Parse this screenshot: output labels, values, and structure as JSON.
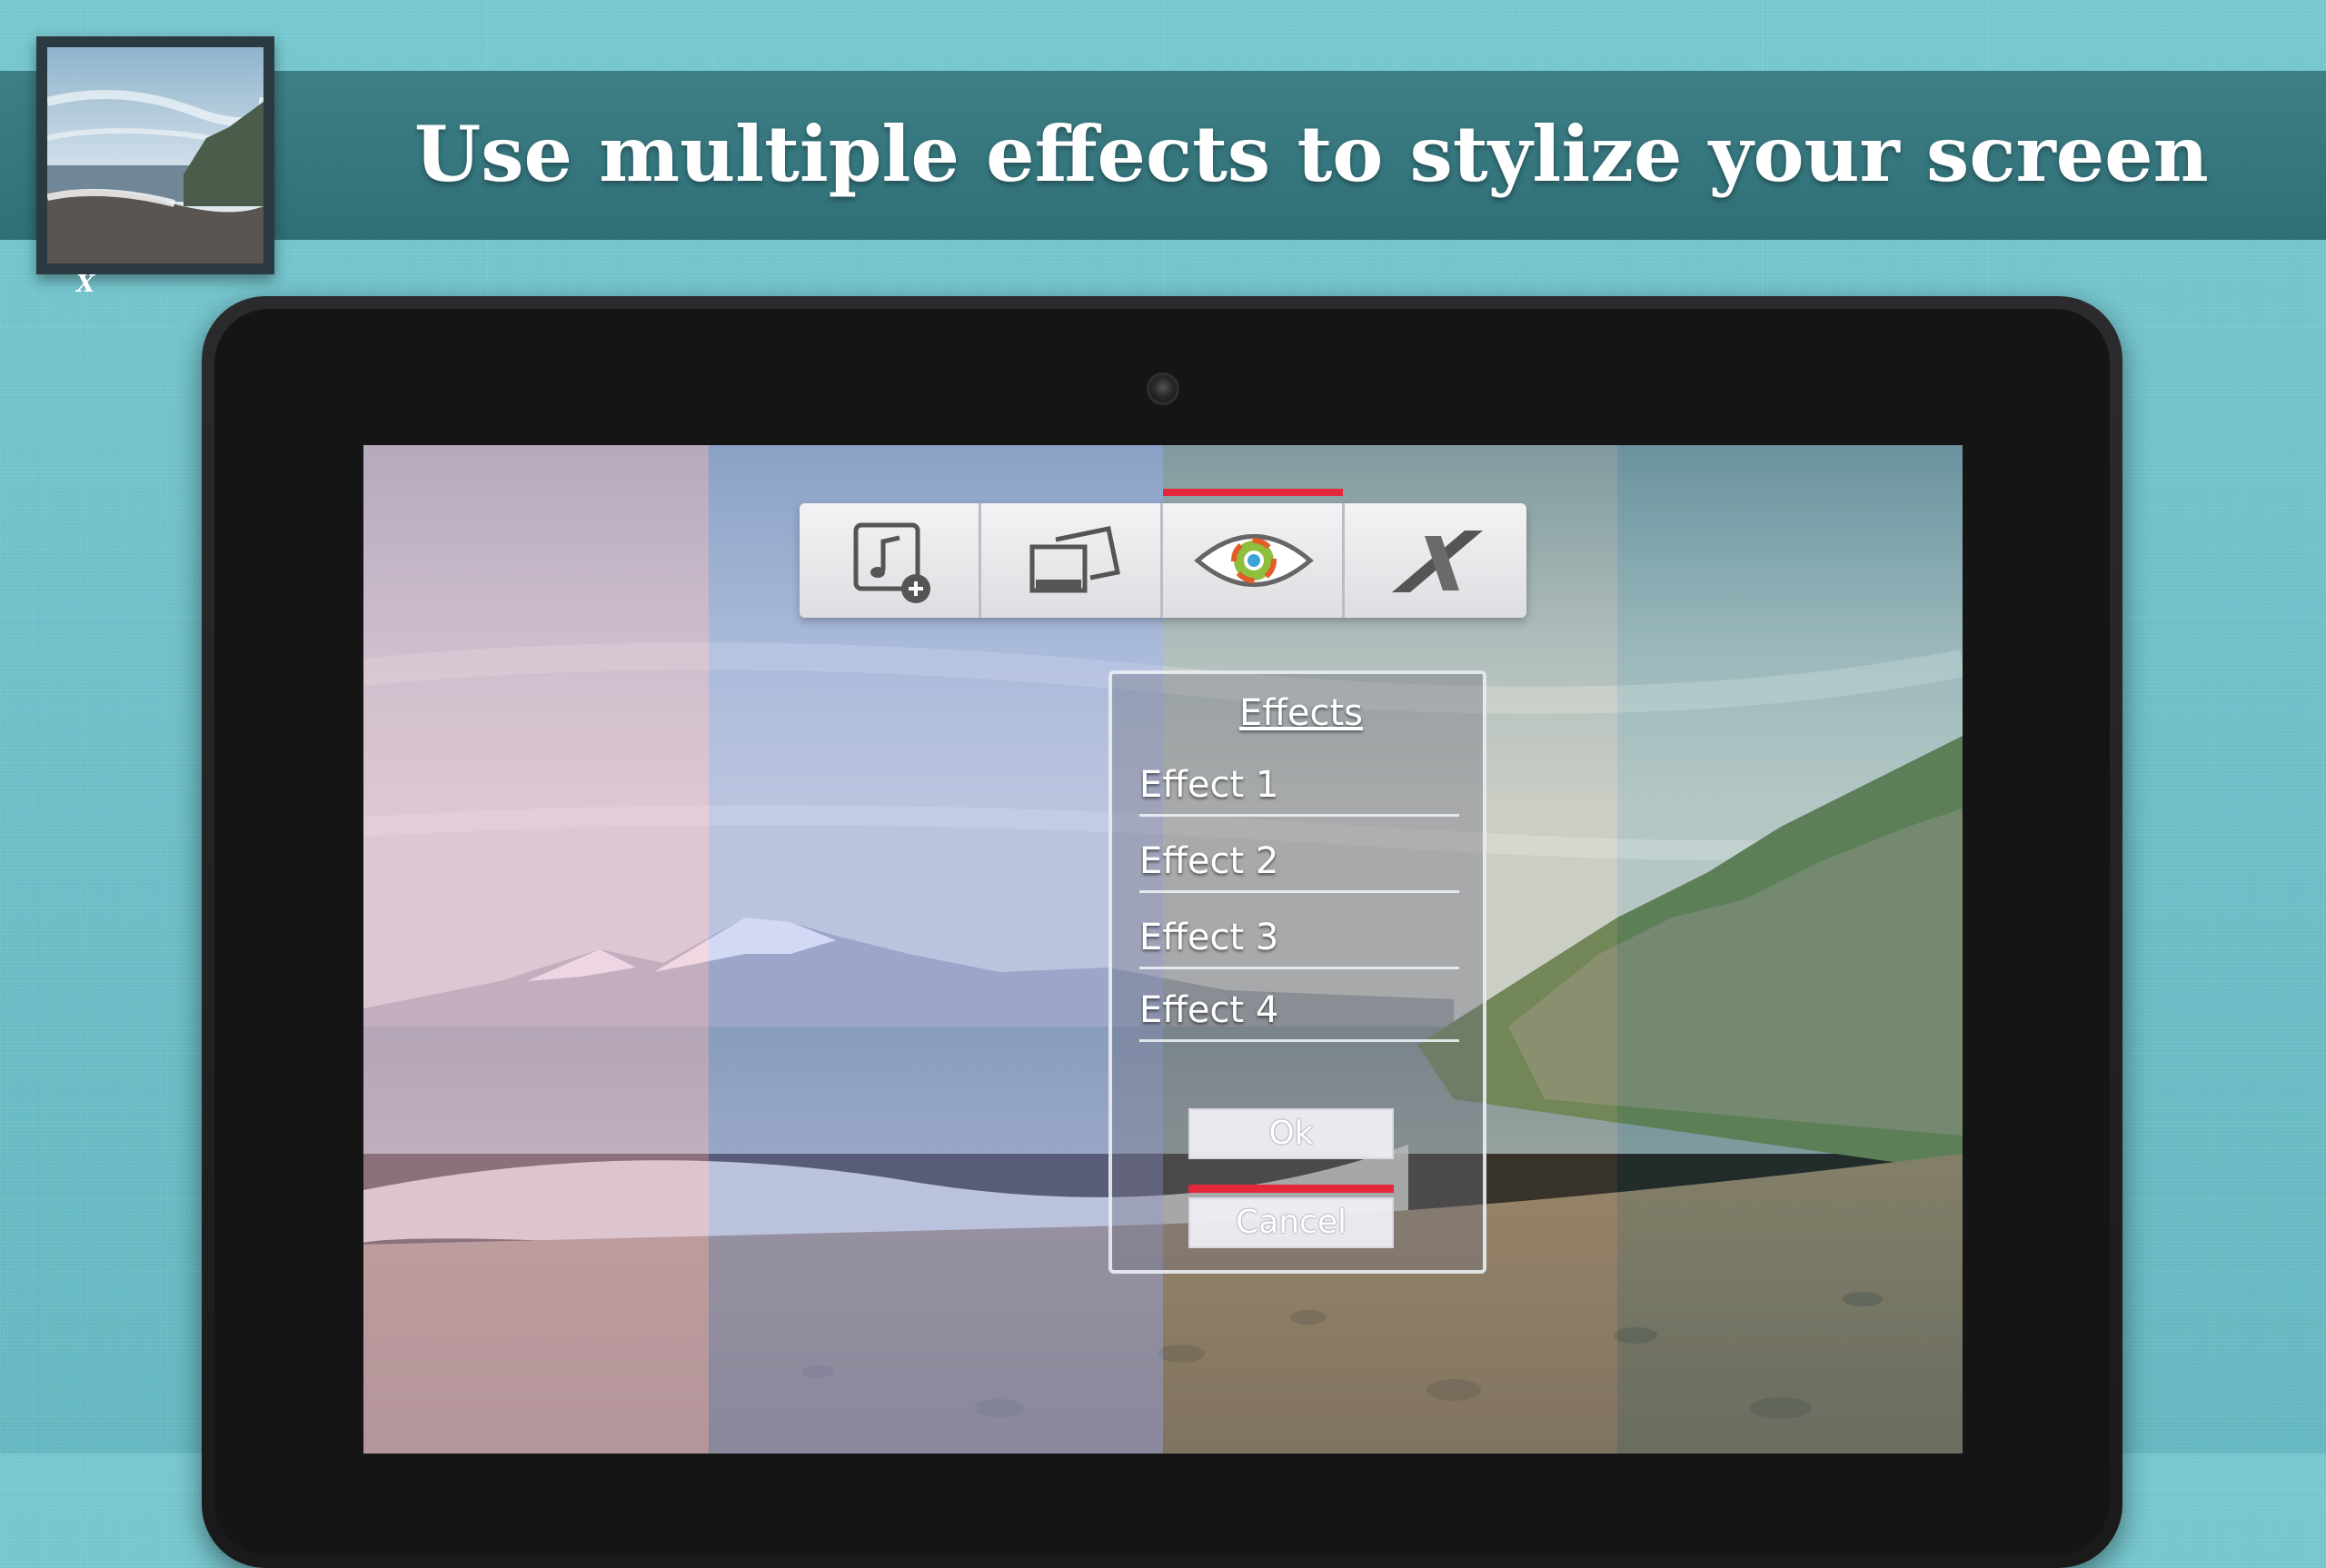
{
  "banner": {
    "title": "Use multiple effects to stylize your screen",
    "app_icon_mark": "X"
  },
  "toolbar": {
    "buttons": [
      {
        "icon": "add-music-icon"
      },
      {
        "icon": "photo-frames-icon"
      },
      {
        "icon": "eye-effects-icon",
        "selected": true
      },
      {
        "icon": "x-logo-icon"
      }
    ],
    "accent_color": "#e3283c"
  },
  "dialog": {
    "title": "Effects",
    "items": [
      {
        "label": "Effect 1"
      },
      {
        "label": "Effect 2"
      },
      {
        "label": "Effect 3"
      },
      {
        "label": "Effect 4"
      }
    ],
    "ok_label": "Ok",
    "cancel_label": "Cancel"
  },
  "colors": {
    "background": "#6cc0c8",
    "banner": "#34747b",
    "tablet_bezel": "#222224",
    "accent": "#e3283c"
  }
}
